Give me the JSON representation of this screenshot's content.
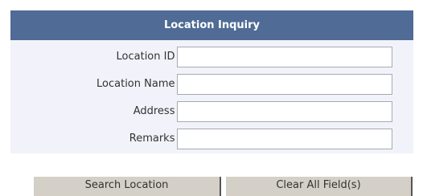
{
  "form": {
    "title": "Location Inquiry",
    "fields": [
      {
        "label": "Location ID :",
        "value": "",
        "placeholder": ""
      },
      {
        "label": "Location Name :",
        "value": "",
        "placeholder": ""
      },
      {
        "label": "Address :",
        "value": "",
        "placeholder": ""
      },
      {
        "label": "Remarks :",
        "value": "",
        "placeholder": ""
      }
    ]
  },
  "buttons": {
    "search_label": "Search Location",
    "clear_label": "Clear All Field(s)"
  },
  "colors": {
    "header_bg": "#4f6b96",
    "panel_bg": "#f2f2fa",
    "button_bg": "#d4d0c8"
  }
}
